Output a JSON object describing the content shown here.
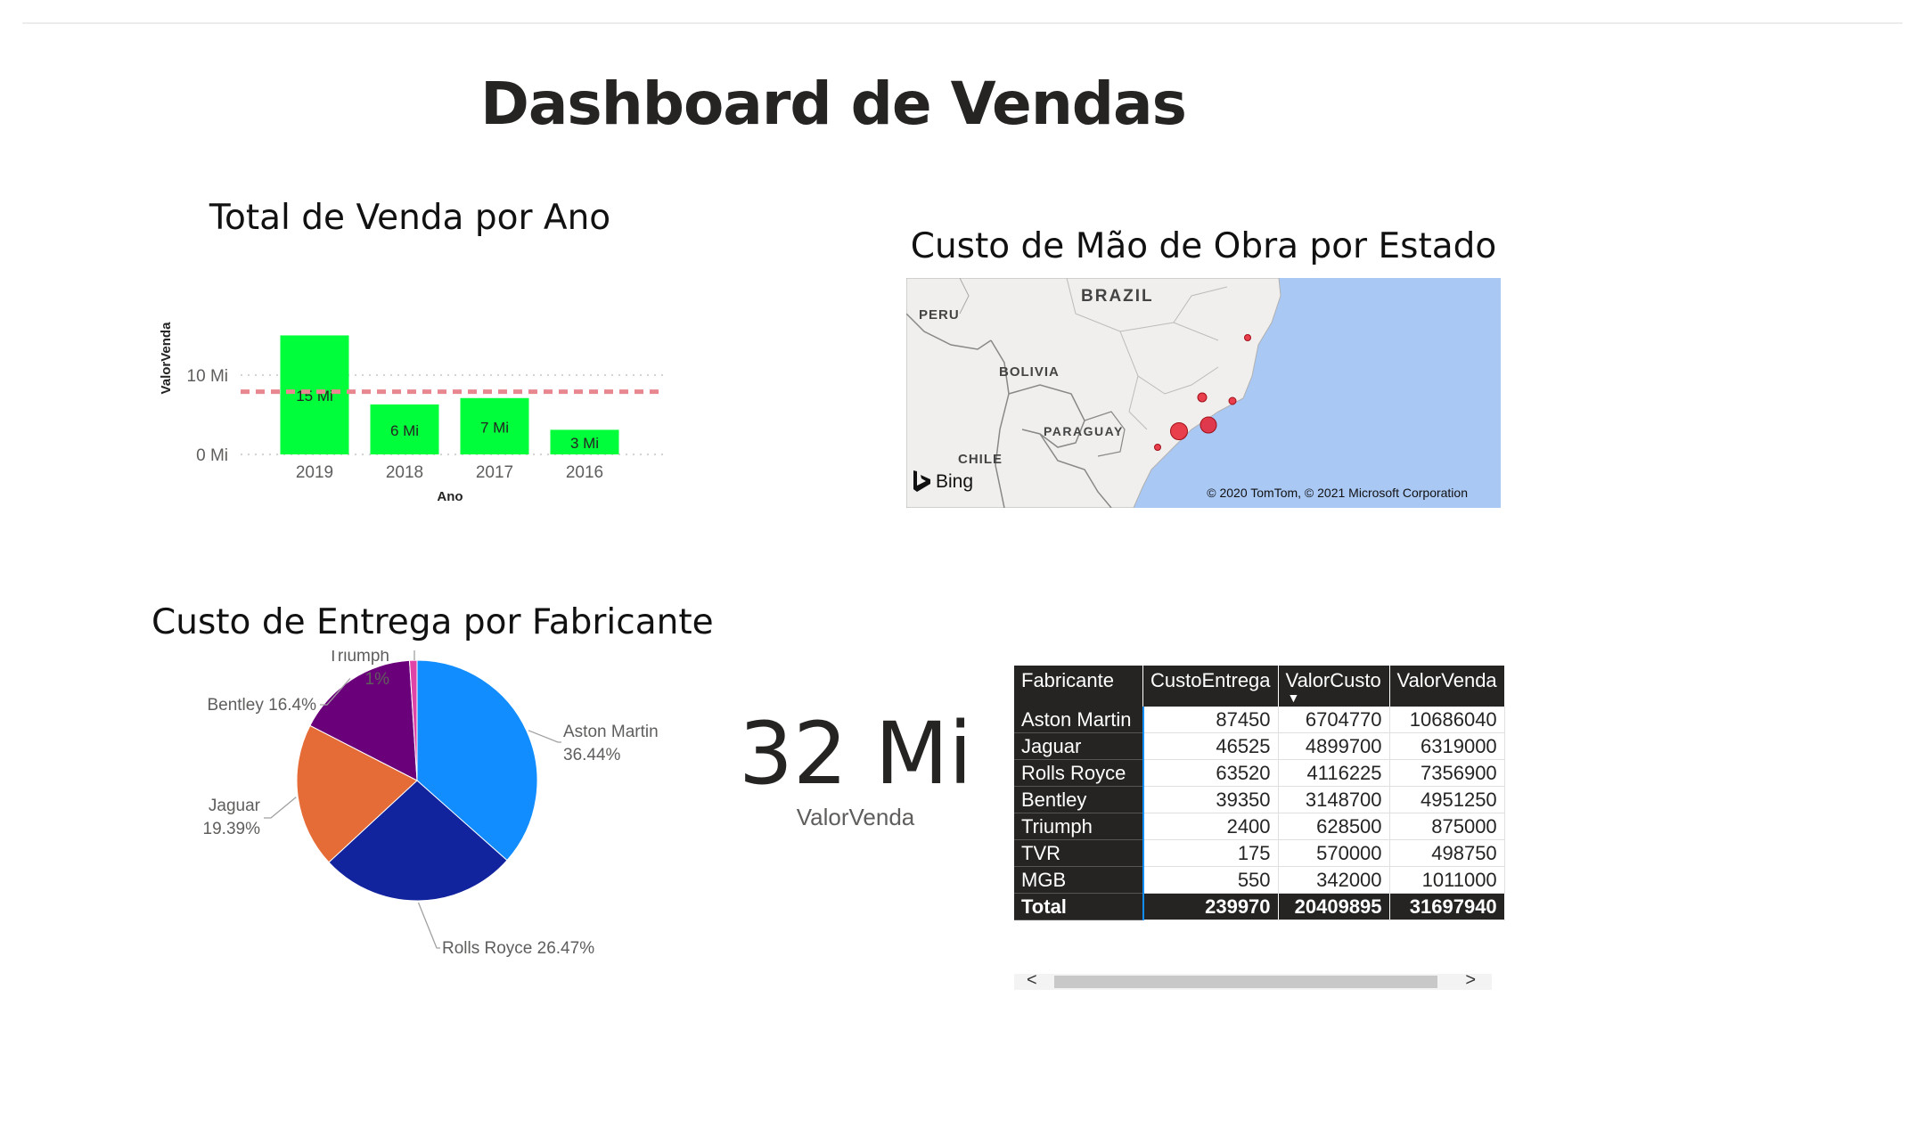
{
  "page": {
    "title": "Dashboard de Vendas"
  },
  "bar_visual": {
    "title": "Total de Venda por Ano"
  },
  "map_visual": {
    "title": "Custo de Mão de Obra por Estado",
    "labels": {
      "brazil": "BRAZIL",
      "peru": "PERU",
      "bolivia": "BOLIVIA",
      "paraguay": "PARAGUAY",
      "chile": "CHILE"
    },
    "bing": "Bing",
    "copyright": "© 2020 TomTom, © 2021 Microsoft Corporation"
  },
  "pie_visual": {
    "title": "Custo de Entrega por Fabricante"
  },
  "card": {
    "value": "32 Mi",
    "label": "ValorVenda"
  },
  "table": {
    "headers": [
      "Fabricante",
      "CustoEntrega",
      "ValorCusto",
      "ValorVenda"
    ],
    "rows": [
      [
        "Aston Martin",
        "87450",
        "6704770",
        "10686040"
      ],
      [
        "Jaguar",
        "46525",
        "4899700",
        "6319000"
      ],
      [
        "Rolls Royce",
        "63520",
        "4116225",
        "7356900"
      ],
      [
        "Bentley",
        "39350",
        "3148700",
        "4951250"
      ],
      [
        "Triumph",
        "2400",
        "628500",
        "875000"
      ],
      [
        "TVR",
        "175",
        "570000",
        "498750"
      ],
      [
        "MGB",
        "550",
        "342000",
        "1011000"
      ]
    ],
    "total": [
      "Total",
      "239970",
      "20409895",
      "31697940"
    ],
    "sort_icon": "caret-down-icon"
  },
  "scrollbar": {
    "left": "<",
    "right": ">"
  },
  "colors": {
    "bar": "#00ff3a",
    "avg_line": "#e8878f",
    "map_bubble": "#e8202f",
    "table_accent": "#118dff"
  },
  "chart_data": [
    {
      "type": "bar",
      "categories": [
        "2019",
        "2018",
        "2017",
        "2016"
      ],
      "values": [
        15,
        6.3,
        7.1,
        3.1
      ],
      "data_labels": [
        "15 Mi",
        "6 Mi",
        "7 Mi",
        "3 Mi"
      ],
      "xlabel": "Ano",
      "ylabel": "ValorVenda",
      "yticks": [
        "0 Mi",
        "10 Mi"
      ],
      "ylim": [
        0,
        16
      ],
      "average_line": 7.9,
      "grid": "dotted"
    },
    {
      "type": "pie",
      "labels": [
        "Aston Martin",
        "Rolls Royce",
        "Jaguar",
        "Bentley",
        "Triumph"
      ],
      "values": [
        36.44,
        26.47,
        19.39,
        16.4,
        1
      ],
      "value_labels": [
        "36.44%",
        "26.47%",
        "19.39%",
        "16.4%",
        "1%"
      ],
      "colors": [
        "#118dff",
        "#12239e",
        "#e66c37",
        "#6b007b",
        "#e044a7"
      ]
    }
  ]
}
